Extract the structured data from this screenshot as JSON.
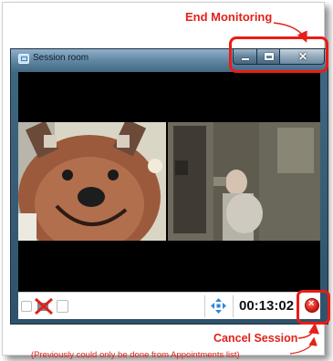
{
  "annotations": {
    "end_monitoring": "End Monitoring",
    "cancel_session": "Cancel Session",
    "previously_note": "(Previously could only be done from Appointments list)"
  },
  "window": {
    "title": "Session room",
    "controls": {
      "minimize_icon": "minimize-icon",
      "maximize_icon": "maximize-icon",
      "close_icon": "close-icon"
    }
  },
  "toolbar": {
    "timer": "00:13:02",
    "icons": [
      "microphone-muted-icon",
      "video-disabled-icon",
      "lock-icon",
      "move-arrows-icon",
      "cancel-session-icon"
    ]
  },
  "colors": {
    "annotation_red": "#e3221b",
    "window_frame": "#2f526b",
    "cancel_red": "#d51c12",
    "move_icon_blue": "#2d86d6"
  }
}
